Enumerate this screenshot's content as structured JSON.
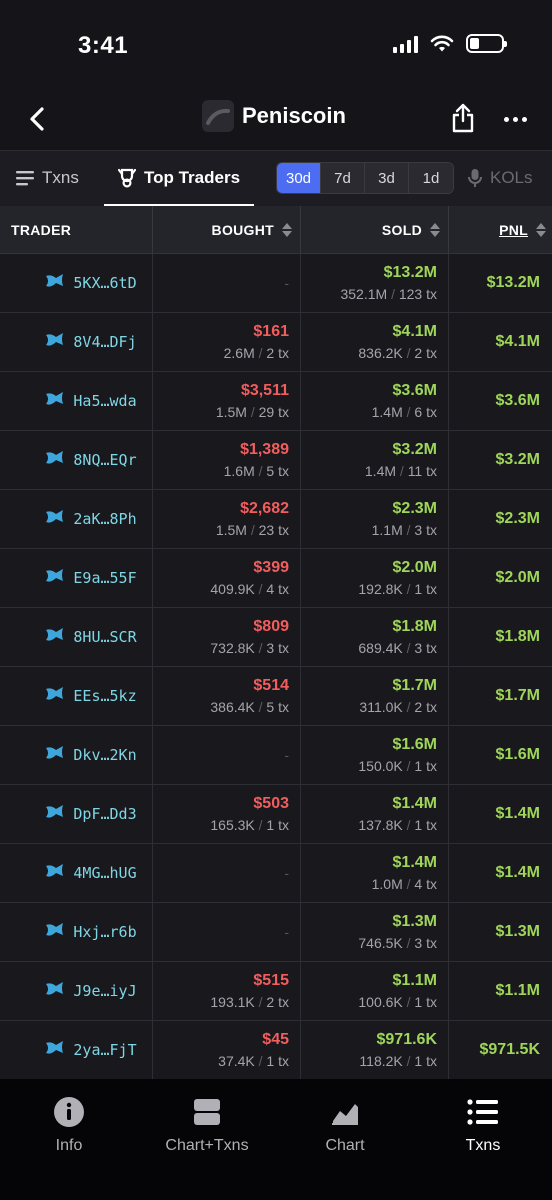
{
  "status_bar": {
    "time": "3:41"
  },
  "header": {
    "title": "Peniscoin"
  },
  "tabs": {
    "txns_label": "Txns",
    "top_traders_label": "Top Traders",
    "ranges": [
      "30d",
      "7d",
      "3d",
      "1d"
    ],
    "active_range": "30d",
    "kols_label": "KOLs"
  },
  "table": {
    "columns": {
      "trader": "TRADER",
      "bought": "BOUGHT",
      "sold": "SOLD",
      "pnl": "PNL"
    },
    "rows": [
      {
        "trader": "5KX…6tD",
        "bought_usd": "-",
        "bought_tokens": "",
        "bought_tx": "",
        "sold_usd": "$13.2M",
        "sold_tokens": "352.1M",
        "sold_tx": "123 tx",
        "pnl": "$13.2M"
      },
      {
        "trader": "8V4…DFj",
        "bought_usd": "$161",
        "bought_tokens": "2.6M",
        "bought_tx": "2 tx",
        "sold_usd": "$4.1M",
        "sold_tokens": "836.2K",
        "sold_tx": "2 tx",
        "pnl": "$4.1M"
      },
      {
        "trader": "Ha5…wda",
        "bought_usd": "$3,511",
        "bought_tokens": "1.5M",
        "bought_tx": "29 tx",
        "sold_usd": "$3.6M",
        "sold_tokens": "1.4M",
        "sold_tx": "6 tx",
        "pnl": "$3.6M"
      },
      {
        "trader": "8NQ…EQr",
        "bought_usd": "$1,389",
        "bought_tokens": "1.6M",
        "bought_tx": "5 tx",
        "sold_usd": "$3.2M",
        "sold_tokens": "1.4M",
        "sold_tx": "11 tx",
        "pnl": "$3.2M"
      },
      {
        "trader": "2aK…8Ph",
        "bought_usd": "$2,682",
        "bought_tokens": "1.5M",
        "bought_tx": "23 tx",
        "sold_usd": "$2.3M",
        "sold_tokens": "1.1M",
        "sold_tx": "3 tx",
        "pnl": "$2.3M"
      },
      {
        "trader": "E9a…55F",
        "bought_usd": "$399",
        "bought_tokens": "409.9K",
        "bought_tx": "4 tx",
        "sold_usd": "$2.0M",
        "sold_tokens": "192.8K",
        "sold_tx": "1 tx",
        "pnl": "$2.0M"
      },
      {
        "trader": "8HU…SCR",
        "bought_usd": "$809",
        "bought_tokens": "732.8K",
        "bought_tx": "3 tx",
        "sold_usd": "$1.8M",
        "sold_tokens": "689.4K",
        "sold_tx": "3 tx",
        "pnl": "$1.8M"
      },
      {
        "trader": "EEs…5kz",
        "bought_usd": "$514",
        "bought_tokens": "386.4K",
        "bought_tx": "5 tx",
        "sold_usd": "$1.7M",
        "sold_tokens": "311.0K",
        "sold_tx": "2 tx",
        "pnl": "$1.7M"
      },
      {
        "trader": "Dkv…2Kn",
        "bought_usd": "-",
        "bought_tokens": "",
        "bought_tx": "",
        "sold_usd": "$1.6M",
        "sold_tokens": "150.0K",
        "sold_tx": "1 tx",
        "pnl": "$1.6M"
      },
      {
        "trader": "DpF…Dd3",
        "bought_usd": "$503",
        "bought_tokens": "165.3K",
        "bought_tx": "1 tx",
        "sold_usd": "$1.4M",
        "sold_tokens": "137.8K",
        "sold_tx": "1 tx",
        "pnl": "$1.4M"
      },
      {
        "trader": "4MG…hUG",
        "bought_usd": "-",
        "bought_tokens": "",
        "bought_tx": "",
        "sold_usd": "$1.4M",
        "sold_tokens": "1.0M",
        "sold_tx": "4 tx",
        "pnl": "$1.4M"
      },
      {
        "trader": "Hxj…r6b",
        "bought_usd": "-",
        "bought_tokens": "",
        "bought_tx": "",
        "sold_usd": "$1.3M",
        "sold_tokens": "746.5K",
        "sold_tx": "3 tx",
        "pnl": "$1.3M"
      },
      {
        "trader": "J9e…iyJ",
        "bought_usd": "$515",
        "bought_tokens": "193.1K",
        "bought_tx": "2 tx",
        "sold_usd": "$1.1M",
        "sold_tokens": "100.6K",
        "sold_tx": "1 tx",
        "pnl": "$1.1M"
      },
      {
        "trader": "2ya…FjT",
        "bought_usd": "$45",
        "bought_tokens": "37.4K",
        "bought_tx": "1 tx",
        "sold_usd": "$971.6K",
        "sold_tokens": "118.2K",
        "sold_tx": "1 tx",
        "pnl": "$971.5K"
      }
    ]
  },
  "bottom_nav": [
    {
      "label": "Info",
      "icon": "info-icon"
    },
    {
      "label": "Chart+Txns",
      "icon": "split-view-icon"
    },
    {
      "label": "Chart",
      "icon": "chart-icon"
    },
    {
      "label": "Txns",
      "icon": "list-icon",
      "active": true
    }
  ],
  "colors": {
    "accent": "#4c6cf2",
    "positive": "#9fd65a",
    "negative": "#f25d5d",
    "address": "#7fd6e4"
  }
}
